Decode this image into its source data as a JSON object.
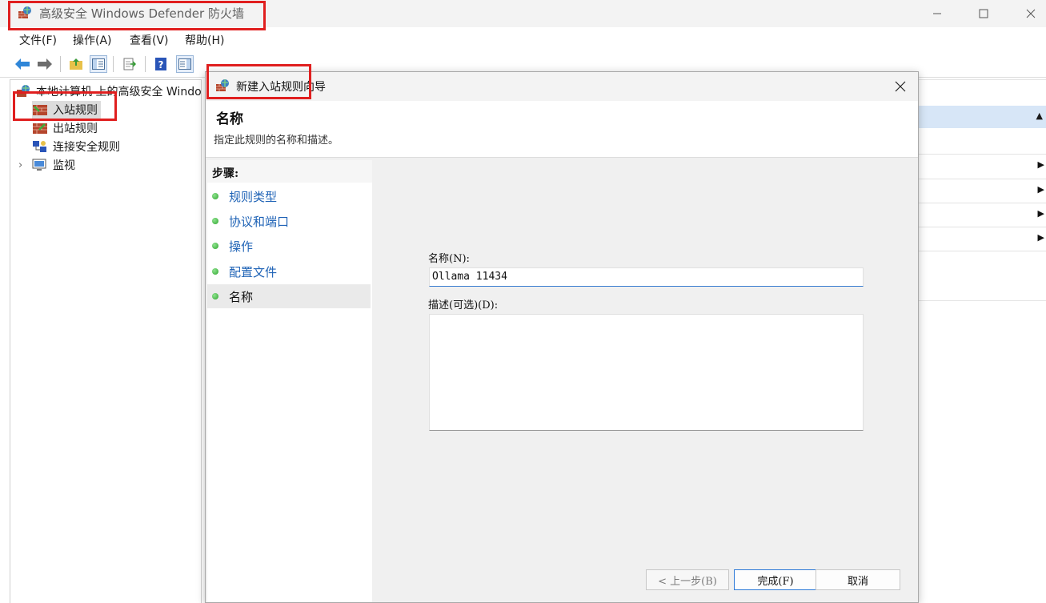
{
  "window": {
    "title": "高级安全 Windows Defender 防火墙",
    "menu": [
      "文件(F)",
      "操作(A)",
      "查看(V)",
      "帮助(H)"
    ]
  },
  "tree": {
    "root": "本地计算机 上的高级安全 Windo",
    "items": [
      {
        "label": "入站规则",
        "selected": true
      },
      {
        "label": "出站规则",
        "selected": false
      },
      {
        "label": "连接安全规则",
        "selected": false
      },
      {
        "label": "监视",
        "selected": false,
        "expandable": true
      }
    ]
  },
  "dialog": {
    "title": "新建入站规则向导",
    "heading": "名称",
    "subtitle": "指定此规则的名称和描述。",
    "steps_title": "步骤:",
    "steps": [
      {
        "label": "规则类型",
        "current": false
      },
      {
        "label": "协议和端口",
        "current": false
      },
      {
        "label": "操作",
        "current": false
      },
      {
        "label": "配置文件",
        "current": false
      },
      {
        "label": "名称",
        "current": true
      }
    ],
    "name_label": "名称(N):",
    "name_value": "Ollama 11434",
    "description_label": "描述(可选)(D):",
    "description_value": "",
    "buttons": {
      "back": "< 上一步(B)",
      "finish": "完成(F)",
      "cancel": "取消"
    }
  },
  "icons": {
    "app": "firewall-icon",
    "back": "arrow-left-icon",
    "forward": "arrow-right-icon",
    "close": "close-icon",
    "minimize": "minimize-icon",
    "maximize": "maximize-icon"
  },
  "colors": {
    "annotation_red": "#e01f1f",
    "link_blue": "#1f63b6",
    "step_dot_green": "#2ea52e"
  }
}
